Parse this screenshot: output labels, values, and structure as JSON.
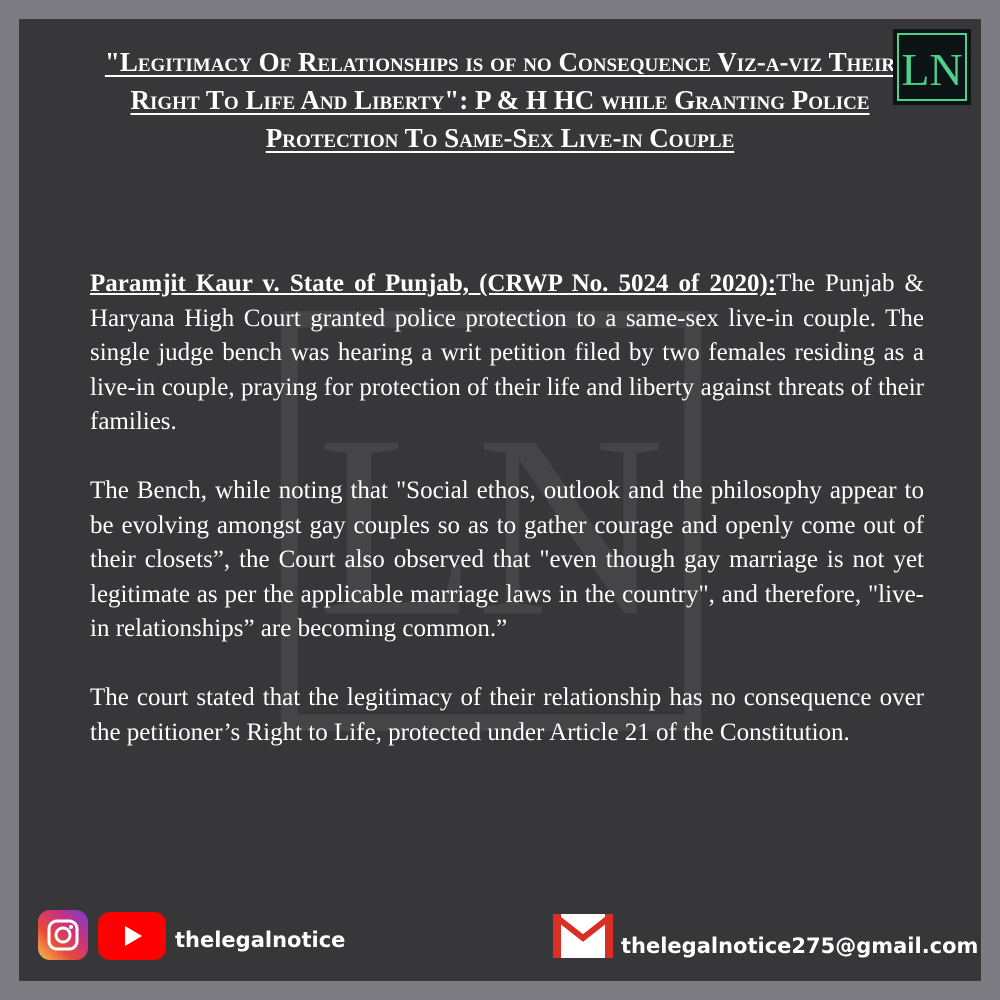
{
  "header": {
    "title": "\"Legitimacy Of Relationships is of no Consequence Viz-a-viz Their Right To Life And Liberty\": P & H HC while Granting Police Protection To Same-Sex Live-in Couple",
    "logo_text": "LN"
  },
  "article": {
    "case_name": "Paramjit Kaur v. State of Punjab, (CRWP No. 5024 of 2020):",
    "para1_rest": "The Punjab & Haryana High Court  granted police protection to a same-sex live-in couple. The single judge bench was hearing a writ petition filed by two females residing as a live-in couple, praying for protection of their life and liberty against threats of their families.",
    "para2": "The Bench, while noting that \"Social ethos, outlook and the philosophy appear to be evolving amongst gay couples so as to gather courage and openly come out of their closets”, the Court also observed that \"even though gay marriage is not yet legitimate as per the applicable marriage laws in the country\", and therefore, \"live-in relationships” are becoming common.”",
    "para3": "The court stated that the legitimacy of their relationship has no consequence over the petitioner’s Right to Life, protected under Article 21 of the Constitution."
  },
  "footer": {
    "social_handle": "thelegalnotice",
    "email": "thelegalnotice275@gmail.com",
    "icons": [
      "instagram-icon",
      "youtube-icon",
      "gmail-icon"
    ]
  },
  "colors": {
    "page_border": "#7c7b82",
    "card_background": "#373639",
    "text": "#ffffff",
    "logo_green": "#4fd08d"
  }
}
